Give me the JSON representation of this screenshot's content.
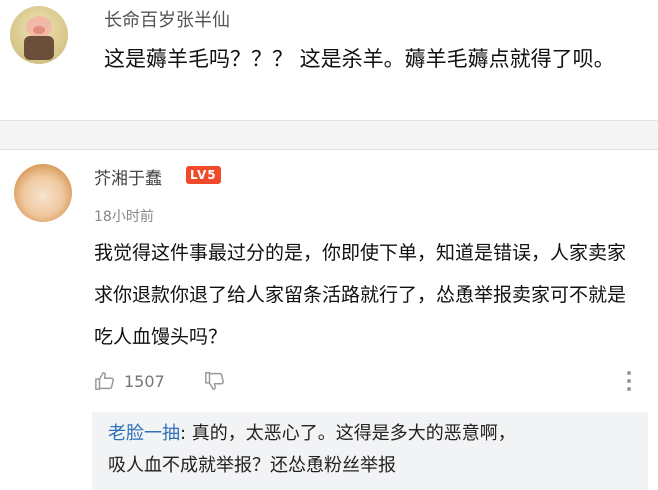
{
  "comment1": {
    "username": "长命百岁张半仙",
    "avatar": "pig-avatar",
    "text": "这是薅羊毛吗？？？ 这是杀羊。薅羊毛薅点就得了呗。"
  },
  "comment2": {
    "username": "芥湘于蠢",
    "level_badge": "LV5",
    "timestamp": "18小时前",
    "avatar": "girl-avatar",
    "text": "我觉得这件事最过分的是，你即使下单，知道是错误，人家卖家求你退款你退了给人家留条活路就行了，怂恿举报卖家可不就是吃人血馒头吗？",
    "like_count": "1507",
    "icons": {
      "like": "thumbs-up-icon",
      "dislike": "thumbs-down-icon",
      "more": "more-vertical-icon"
    },
    "reply": {
      "author": "老脸一抽",
      "separator": ":",
      "line1": " 真的，太恶心了。这得是多大的恶意啊，",
      "line2": "吸人血不成就举报？还怂恿粉丝举报"
    }
  },
  "colors": {
    "reply_name": "#2d6fb8",
    "level_badge": "#f04a2a",
    "reply_bg": "#f2f3f5"
  }
}
